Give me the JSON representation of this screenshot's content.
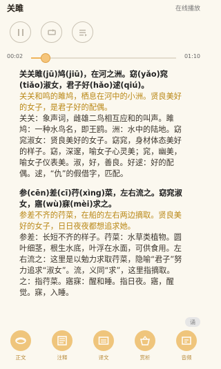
{
  "header": {
    "title": "关雎",
    "status": "在线播放"
  },
  "controls": {
    "pause_icon": "pause-icon",
    "repeat_icon": "repeat-icon",
    "menu_icon": "menu-list-icon"
  },
  "progress": {
    "current": "00:02",
    "total": "01:10",
    "fraction": 0.1
  },
  "content": {
    "line1": "关关雎(jū)鸠(jiū)，在河之洲。窈(yǎo)窕(tiǎo)淑女，君子好(hǎo)逑(qiú)。",
    "trans1": "关关和鸣的雎鸠，栖息在河中的小洲。贤良美好的女子，是君子好的配偶。",
    "note1": "关关：象声词，雌雄二鸟相互应和的叫声。雎鸠：一种水鸟名，即王鸥。洲：水中的陆地。窈窕淑女：贤良美好的女子。窈窕，身材体态美好的样子。窈，深邃，喻女子心灵美；窕，幽美，喻女子仪表美。淑，好，善良。好逑：好的配偶。逑，“仇”的假借字，匹配。",
    "line2": "参(cēn)差(cī)荇(xìng)菜，左右流之。窈窕淑女，寤(wù)寐(mèi)求之。",
    "trans2": "参差不齐的荇菜，在船的左右两边摘取。贤良美好的女子，日日夜夜都想追求她。",
    "note2": "参差：长短不齐的样子。荇菜：水草类植物。圆叶细茎，根生水底，叶浮在水面，可供食用。左右流之：这里是以勉力求取荇菜，隐喻“君子”努力追求“淑女”。流，义同“求”，这里指摘取。之：指荇菜。寤寐：醒和睡。指日夜。寤，醒觉。寐，入睡。"
  },
  "side_pill": "诵",
  "tabs": [
    {
      "label": "正文",
      "icon": "text-icon"
    },
    {
      "label": "注释",
      "icon": "notes-icon"
    },
    {
      "label": "译文",
      "icon": "translation-icon"
    },
    {
      "label": "赏析",
      "icon": "analysis-icon"
    },
    {
      "label": "音频",
      "icon": "audio-icon"
    }
  ],
  "colors": {
    "accent": "#f0b45a",
    "gold_text": "#b98715",
    "tab_icon_bg": "#efc57c",
    "background": "#fbf8ef"
  }
}
